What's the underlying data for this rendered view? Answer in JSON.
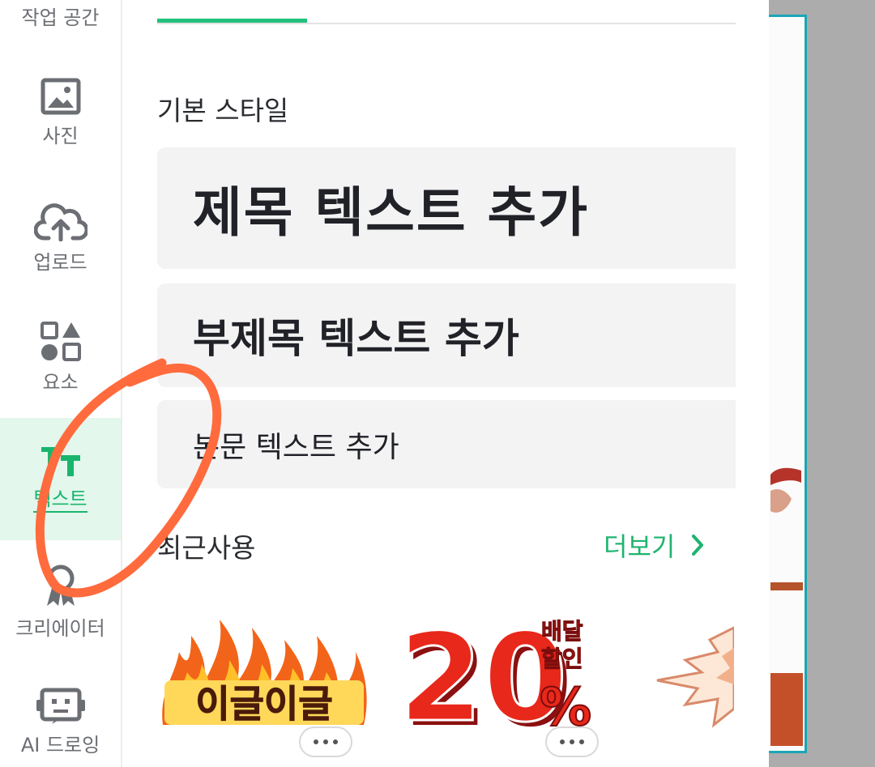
{
  "sidebar": {
    "items": [
      {
        "label": "작업 공간",
        "icon": "workspace-icon"
      },
      {
        "label": "사진",
        "icon": "photo-icon"
      },
      {
        "label": "업로드",
        "icon": "cloud-upload-icon"
      },
      {
        "label": "요소",
        "icon": "shapes-icon"
      },
      {
        "label": "텍스트",
        "icon": "text-icon",
        "active": true
      },
      {
        "label": "크리에이터",
        "icon": "creator-icon"
      },
      {
        "label": "AI 드로잉",
        "icon": "robot-icon"
      }
    ]
  },
  "panel": {
    "basic_style_title": "기본 스타일",
    "add_title": "제목 텍스트 추가",
    "add_subtitle": "부제목 텍스트 추가",
    "add_body": "본문 텍스트 추가",
    "recent_title": "최근사용",
    "more_label": "더보기",
    "recent_items": [
      {
        "text": "이글이글"
      },
      {
        "text": "20",
        "suffix": "%",
        "side_text_1": "배달",
        "side_text_2": "할인"
      }
    ]
  },
  "colors": {
    "accent": "#24c07c",
    "active_bg": "#e3f7ec",
    "card_bg": "#f3f3f4",
    "canvas_border": "#1aa6b5",
    "annotation": "#ff6b3d"
  }
}
